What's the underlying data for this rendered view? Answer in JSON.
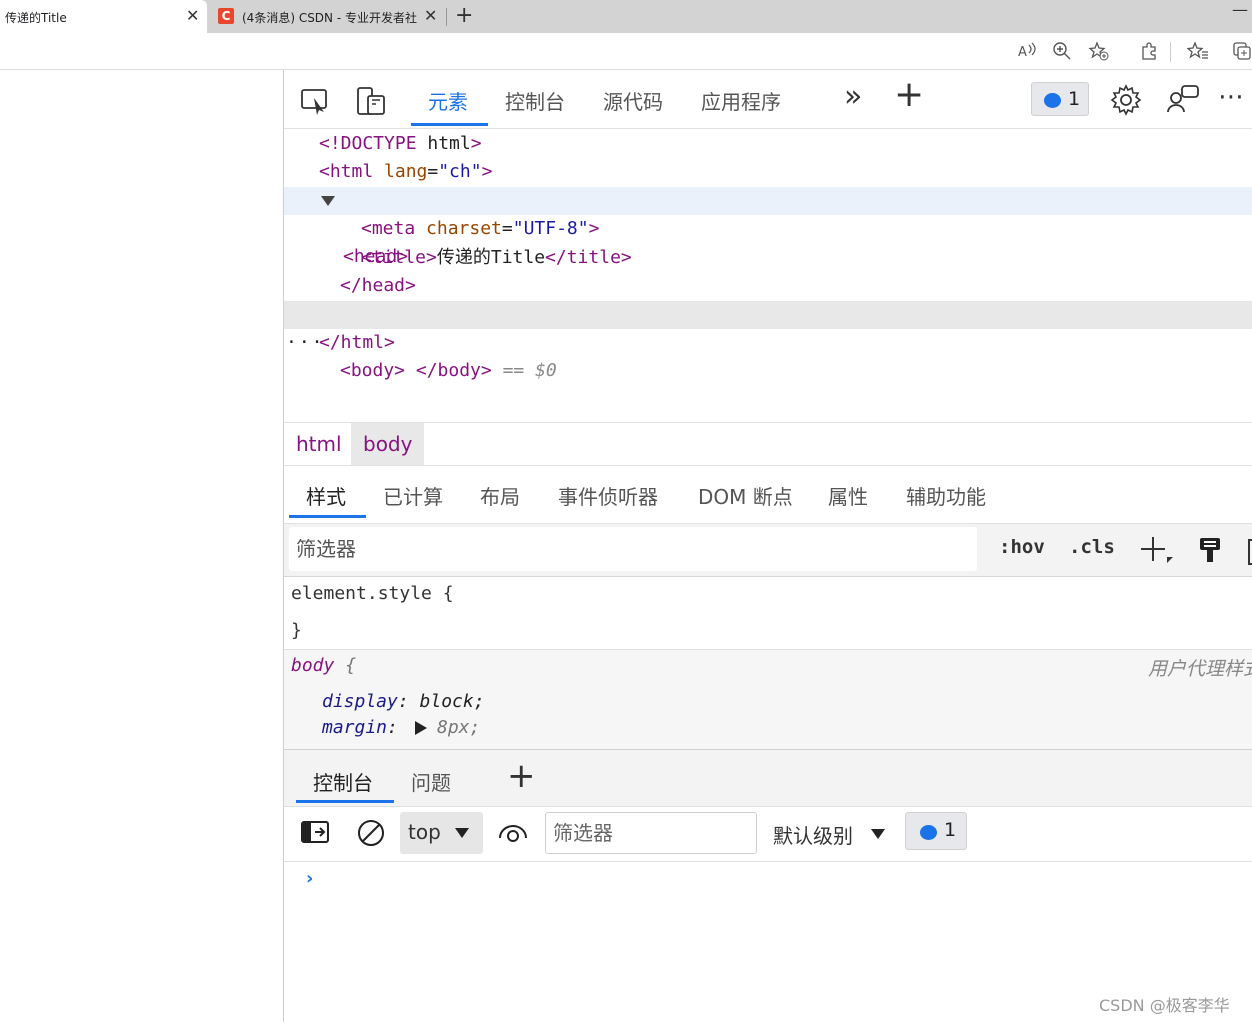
{
  "browser": {
    "tabs": [
      {
        "title": "传递的Title",
        "active": true
      },
      {
        "title": "(4条消息) CSDN - 专业开发者社区",
        "active": false
      }
    ],
    "close_glyph": "✕",
    "new_tab_glyph": "+"
  },
  "devtools": {
    "main_tabs": [
      "元素",
      "控制台",
      "源代码",
      "应用程序"
    ],
    "more_tabs_glyph": "»",
    "add_tab_glyph": "+",
    "issues_count": "1",
    "more_glyph": "⋯",
    "dom_lines": [
      {
        "parts": [
          [
            "tg",
            "<!DOCTYPE"
          ],
          [
            "tx",
            " html"
          ],
          [
            "tg",
            ">"
          ]
        ]
      },
      {
        "parts": [
          [
            "tg",
            "<html"
          ],
          [
            "an",
            " lang"
          ],
          [
            "tx",
            "="
          ],
          [
            "av",
            "\"ch\""
          ],
          [
            "tg",
            ">"
          ]
        ]
      },
      {
        "parts": [
          [
            "tg",
            "<head>"
          ]
        ]
      },
      {
        "parts": [
          [
            "tg",
            "<meta"
          ],
          [
            "an",
            " charset"
          ],
          [
            "tx",
            "="
          ],
          [
            "av",
            "\"UTF-8\""
          ],
          [
            "tg",
            ">"
          ]
        ]
      },
      {
        "parts": [
          [
            "tg",
            "<title>"
          ],
          [
            "tx",
            "传递的Title"
          ],
          [
            "tg",
            "</title>"
          ]
        ]
      },
      {
        "parts": [
          [
            "tg",
            "</head>"
          ]
        ]
      },
      {
        "parts": [
          [
            "tg",
            "<body>"
          ],
          [
            "tx",
            " "
          ],
          [
            "tg",
            "</body>"
          ],
          [
            "eq",
            " == $0"
          ]
        ]
      },
      {
        "parts": [
          [
            "tg",
            "</html>"
          ]
        ]
      }
    ],
    "ellipsis": "···",
    "breadcrumbs": [
      "html",
      "body"
    ],
    "styles_tabs": [
      "样式",
      "已计算",
      "布局",
      "事件侦听器",
      "DOM 断点",
      "属性",
      "辅助功能"
    ],
    "filter_placeholder": "筛选器",
    "hov": ":hov",
    "cls": ".cls",
    "rules": {
      "element_style_open": "element.style {",
      "element_style_close": "}",
      "ua_selector": "body",
      "ua_brace": " {",
      "ua_origin": "用户代理样式表",
      "decls": [
        {
          "prop": "display",
          "value": "block;"
        },
        {
          "prop": "margin",
          "value": "8px;"
        }
      ]
    },
    "drawer": {
      "tabs": [
        "控制台",
        "问题"
      ],
      "add_glyph": "+",
      "context": "top",
      "filter_placeholder": "筛选器",
      "level": "默认级别",
      "issues_count": "1",
      "prompt": "›"
    }
  },
  "watermark": "CSDN @极客李华"
}
